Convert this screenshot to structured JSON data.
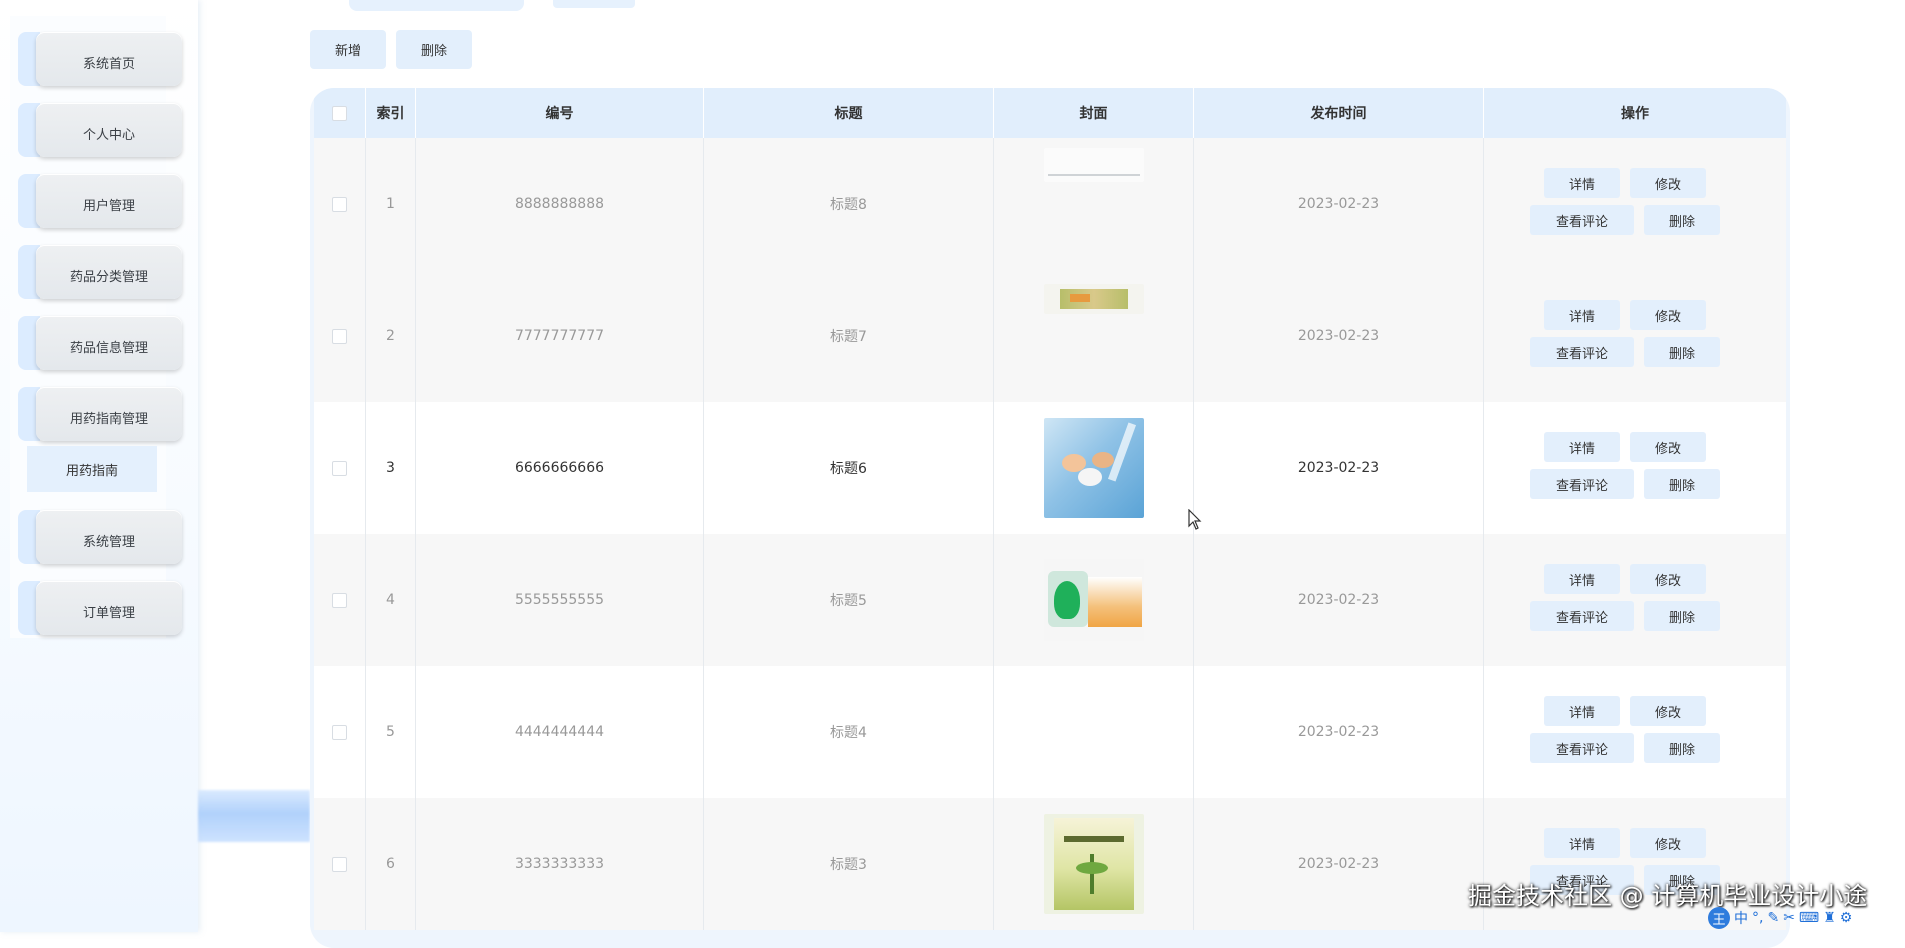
{
  "sidebar": {
    "items": [
      {
        "label": "系统首页"
      },
      {
        "label": "个人中心"
      },
      {
        "label": "用户管理"
      },
      {
        "label": "药品分类管理"
      },
      {
        "label": "药品信息管理"
      },
      {
        "label": "用药指南管理"
      },
      {
        "label": "系统管理"
      },
      {
        "label": "订单管理"
      }
    ],
    "submenu": {
      "label": "用药指南"
    }
  },
  "toolbar": {
    "add_label": "新增",
    "delete_label": "删除"
  },
  "table": {
    "headers": {
      "index": "索引",
      "number": "编号",
      "title": "标题",
      "cover": "封面",
      "publish_time": "发布时间",
      "actions": "操作"
    },
    "rows": [
      {
        "index": "1",
        "number": "8888888888",
        "title": "标题8",
        "date": "2023-02-23"
      },
      {
        "index": "2",
        "number": "7777777777",
        "title": "标题7",
        "date": "2023-02-23"
      },
      {
        "index": "3",
        "number": "6666666666",
        "title": "标题6",
        "date": "2023-02-23"
      },
      {
        "index": "4",
        "number": "5555555555",
        "title": "标题5",
        "date": "2023-02-23"
      },
      {
        "index": "5",
        "number": "4444444444",
        "title": "标题4",
        "date": "2023-02-23"
      },
      {
        "index": "6",
        "number": "3333333333",
        "title": "标题3",
        "date": "2023-02-23"
      }
    ],
    "row_actions": {
      "detail": "详情",
      "edit": "修改",
      "comments": "查看评论",
      "delete": "删除"
    }
  },
  "watermark": "掘金技术社区 @ 计算机毕业设计小途",
  "ime": {
    "logo": "王",
    "mode": "中"
  }
}
